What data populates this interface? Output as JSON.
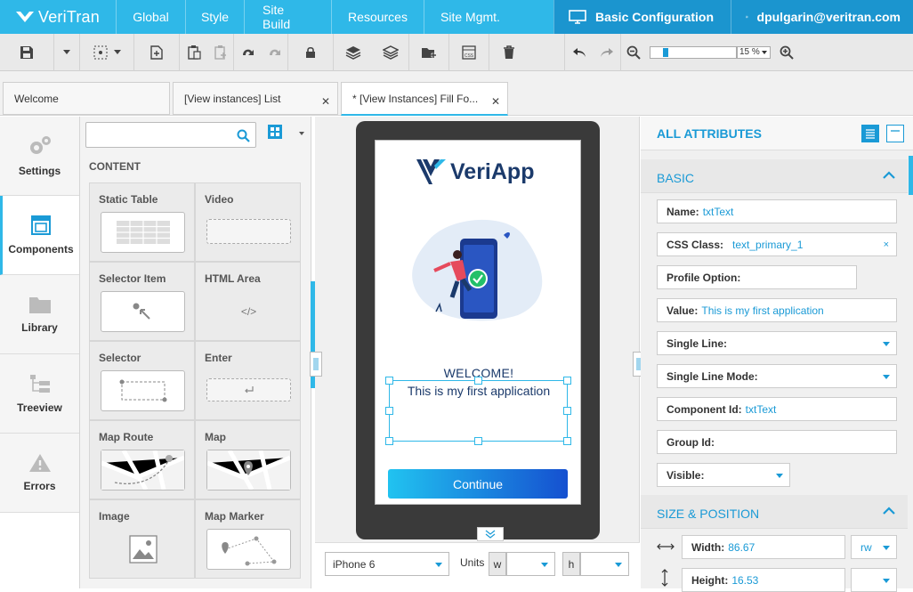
{
  "brand": {
    "name": "VeriTran",
    "accent": "#2fb8e8"
  },
  "nav": {
    "items": [
      "Global",
      "Style",
      "Site Build",
      "Resources",
      "Site Mgmt."
    ],
    "config": "Basic Configuration",
    "user": "dpulgarin@veritran.com"
  },
  "toolbar": {
    "zoom_value": "15 %",
    "zoom_level": 0.15,
    "icons": [
      "save-icon",
      "dropdown-icon",
      "select-icon",
      "dropdown-icon",
      "add-page-icon",
      "paste-icon",
      "paste-disabled-icon",
      "wrap-icon",
      "unwrap-icon",
      "lock-icon",
      "layers-icon",
      "layers-stack-icon",
      "add-folder-icon",
      "css-icon",
      "trash-icon",
      "undo-icon",
      "redo-icon",
      "zoom-out-icon",
      "zoom-in-icon"
    ]
  },
  "tabs": [
    {
      "label": "Welcome"
    },
    {
      "label": "[View instances] List"
    },
    {
      "label": "* [View Instances] Fill Fo..."
    }
  ],
  "leftbar": {
    "items": [
      {
        "label": "Settings",
        "icon": "gear-icon"
      },
      {
        "label": "Components",
        "icon": "components-icon"
      },
      {
        "label": "Library",
        "icon": "folder-icon"
      },
      {
        "label": "Treeview",
        "icon": "tree-icon"
      },
      {
        "label": "Errors",
        "icon": "warning-icon"
      }
    ]
  },
  "components": {
    "heading": "CONTENT",
    "items": [
      {
        "label": "Static Table"
      },
      {
        "label": "Video"
      },
      {
        "label": "Selector Item"
      },
      {
        "label": "HTML Area",
        "preview_text": "</>"
      },
      {
        "label": "Selector"
      },
      {
        "label": "Enter"
      },
      {
        "label": "Map Route"
      },
      {
        "label": "Map"
      },
      {
        "label": "Image"
      },
      {
        "label": "Map Marker"
      }
    ]
  },
  "canvas": {
    "app_name": "VeriApp",
    "welcome": "WELCOME!",
    "subtext": "This is my first application",
    "button": "Continue",
    "device": "iPhone 6",
    "units_label": "Units",
    "unit_w": "w",
    "unit_h": "h"
  },
  "attributes": {
    "title": "ALL ATTRIBUTES",
    "basic_title": "BASIC",
    "fields": {
      "name_k": "Name:",
      "name_v": "txtText",
      "css_k": "CSS Class:",
      "css_v": "text_primary_1",
      "css_clear": "×",
      "profile_k": "Profile Option:",
      "value_k": "Value:",
      "value_v": "This is my first application",
      "single_line_k": "Single Line:",
      "single_line_mode_k": "Single Line Mode:",
      "component_id_k": "Component Id:",
      "component_id_v": "txtText",
      "group_id_k": "Group Id:",
      "visible_k": "Visible:"
    },
    "size_title": "SIZE & POSITION",
    "width_k": "Width:",
    "width_v": "86.67",
    "width_unit": "rw",
    "height_k": "Height:",
    "height_v": "16.53"
  }
}
